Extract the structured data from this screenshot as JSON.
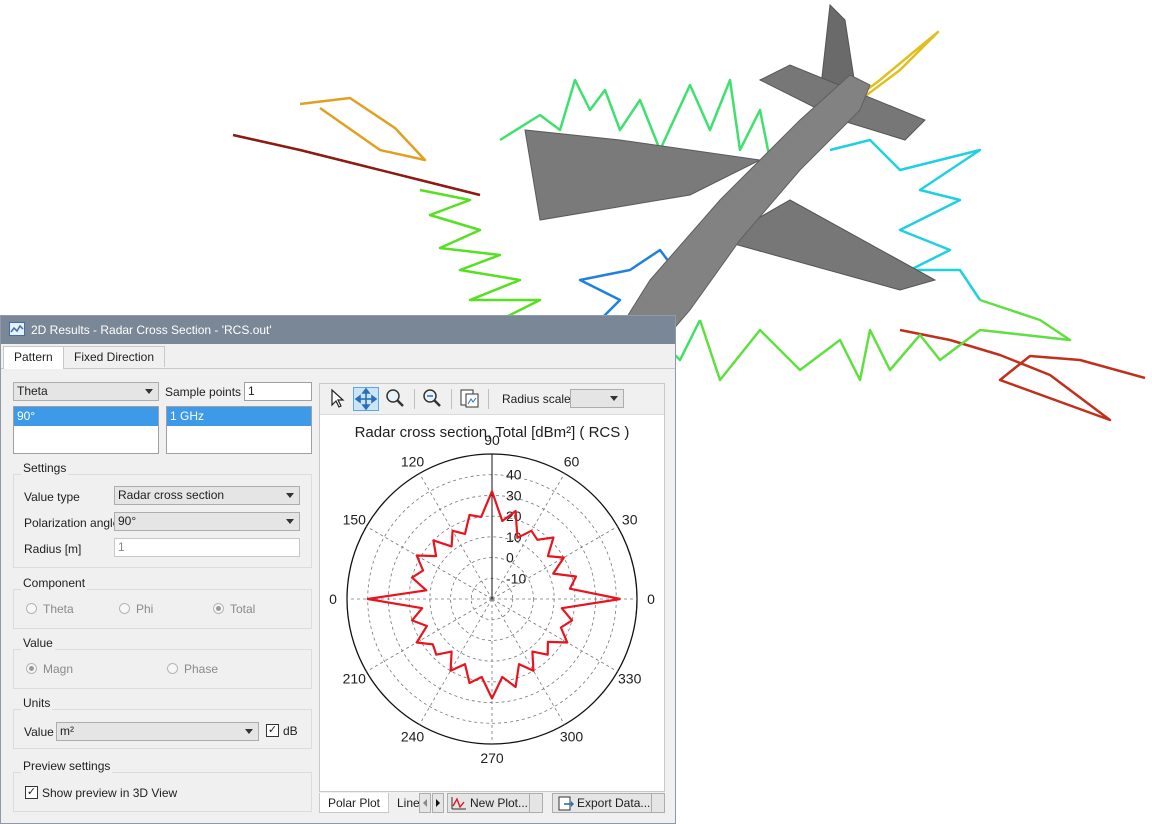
{
  "window": {
    "title": "2D Results - Radar Cross Section - 'RCS.out'",
    "tabs": [
      "Pattern",
      "Fixed Direction"
    ],
    "active_tab": "Pattern"
  },
  "pattern": {
    "axis_select": "Theta",
    "sample_points_label": "Sample points",
    "sample_points_value": "1",
    "axis_list": [
      "90°"
    ],
    "sample_list": [
      "1 GHz"
    ]
  },
  "settings": {
    "group_label": "Settings",
    "value_type_label": "Value type",
    "value_type": "Radar cross section",
    "polarization_label": "Polarization angle",
    "polarization": "90°",
    "radius_label": "Radius [m]",
    "radius_value": "1"
  },
  "component": {
    "group_label": "Component",
    "options": [
      "Theta",
      "Phi",
      "Total"
    ],
    "selected": "Total"
  },
  "value": {
    "group_label": "Value",
    "options": [
      "Magn",
      "Phase"
    ],
    "selected": "Magn"
  },
  "units": {
    "group_label": "Units",
    "value_label": "Value",
    "unit": "m²",
    "db_label": "dB",
    "db_checked": true
  },
  "preview": {
    "group_label": "Preview settings",
    "show_3d_label": "Show preview in 3D View",
    "checked": true
  },
  "toolbar": {
    "radius_scale_label": "Radius scale"
  },
  "bottom_tabs": {
    "polar_plot": "Polar Plot",
    "line_plot": "Line",
    "new_plot": "New Plot...",
    "export_data": "Export Data..."
  },
  "colors": {
    "plot_line": "#e8141e",
    "titlebar": "#7a8796",
    "selection": "#3d9ae8",
    "aircraft": "#6e6e6e"
  },
  "chart_data": {
    "type": "polar",
    "title": "Radar cross section, Total  [dBm²] ( RCS )",
    "angle_ticks": [
      90,
      60,
      30,
      0,
      330,
      300,
      270,
      240,
      210,
      0,
      150,
      120
    ],
    "radial_ticks": [
      40,
      30,
      20,
      10,
      0,
      -10
    ],
    "radial_range": [
      -20,
      50
    ],
    "series": [
      {
        "angles_deg": [
          0,
          7.5,
          15,
          22.5,
          30,
          37.5,
          45,
          52.5,
          60,
          67.5,
          75,
          82.5,
          90,
          97.5,
          105,
          112.5,
          120,
          127.5,
          135,
          142.5,
          150,
          157.5,
          165,
          172.5,
          180,
          187.5,
          195,
          202.5,
          210,
          217.5,
          225,
          232.5,
          240,
          247.5,
          255,
          262.5,
          270,
          277.5,
          285,
          292.5,
          300,
          307.5,
          315,
          322.5,
          330,
          337.5,
          345,
          352.5
        ],
        "values_db": [
          42,
          18,
          22,
          12,
          20,
          14,
          22,
          16,
          18,
          12,
          24,
          18,
          32,
          20,
          22,
          14,
          18,
          12,
          20,
          14,
          22,
          16,
          20,
          12,
          40,
          14,
          20,
          14,
          22,
          16,
          18,
          12,
          20,
          14,
          22,
          18,
          28,
          18,
          24,
          14,
          20,
          12,
          18,
          14,
          22,
          16,
          20,
          14
        ]
      }
    ],
    "grid": true
  }
}
